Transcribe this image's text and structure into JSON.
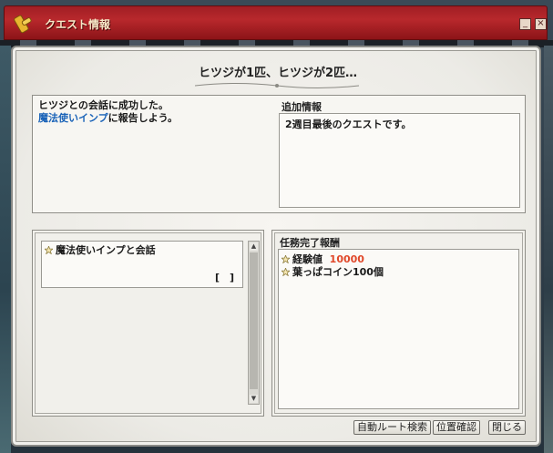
{
  "window": {
    "title": "クエスト情報"
  },
  "quest": {
    "title": "ヒツジが1匹、ヒツジが2匹…"
  },
  "description": {
    "line1": "ヒツジとの会話に成功した。",
    "line2_link": "魔法使いインプ",
    "line2_rest": "に報告しよう。"
  },
  "additional_info": {
    "header": "追加情報",
    "text": "2週目最後のクエストです。"
  },
  "objectives": [
    {
      "label": "魔法使いインプと会話",
      "progress": "[　]"
    }
  ],
  "rewards": {
    "header": "任務完了報酬",
    "items": [
      {
        "label": "経験値",
        "value": "10000"
      },
      {
        "label": "葉っぱコイン100個",
        "value": ""
      }
    ]
  },
  "buttons": {
    "auto_route": "自動ルート検索",
    "location": "位置確認",
    "close": "閉じる"
  },
  "colors": {
    "titlebar": "#b8282c",
    "link": "#1a63b8",
    "highlight": "#e0482a"
  }
}
